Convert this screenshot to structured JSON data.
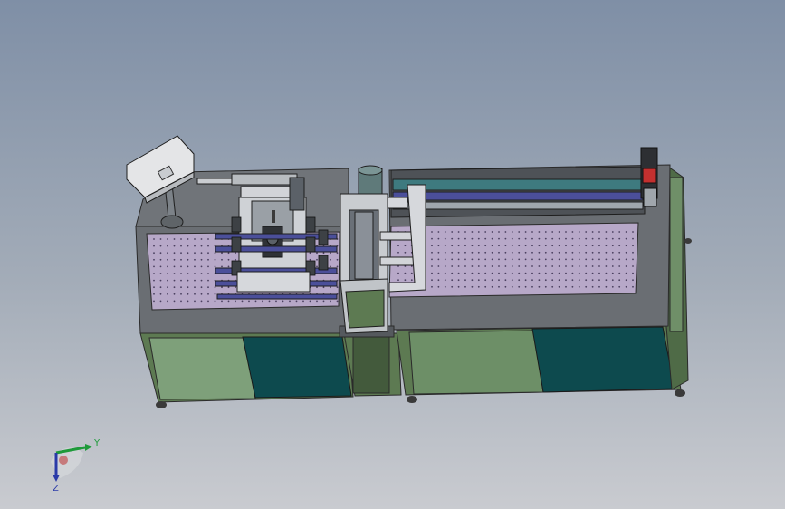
{
  "triad": {
    "y_label": "Y",
    "z_label": "Z",
    "colors": {
      "y_axis": "#1e9a3a",
      "z_axis": "#2a3aa8",
      "x_axis": "#c04040"
    }
  },
  "scene": {
    "background_top": "#7f8fa6",
    "background_bottom": "#c9cbd0",
    "frame_color": "#5d7a52",
    "panel_color": "#0d4a4e",
    "deck_color": "#6a6e73",
    "plate_color": "#b7a8c8",
    "rail_color": "#4b4f9a"
  }
}
